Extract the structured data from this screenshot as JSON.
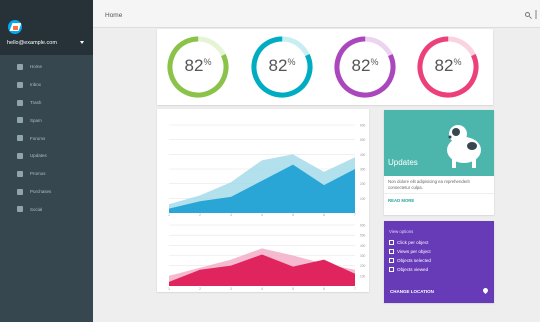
{
  "account": {
    "email": "hello@example.com"
  },
  "header": {
    "title": "Home"
  },
  "sidebar": {
    "items": [
      {
        "label": "Home",
        "icon": "home-icon"
      },
      {
        "label": "Inbox",
        "icon": "inbox-icon"
      },
      {
        "label": "Trash",
        "icon": "trash-icon"
      },
      {
        "label": "Spam",
        "icon": "spam-icon"
      },
      {
        "label": "Forums",
        "icon": "forums-icon"
      },
      {
        "label": "Updates",
        "icon": "flag-icon"
      },
      {
        "label": "Promos",
        "icon": "tag-icon"
      },
      {
        "label": "Purchases",
        "icon": "cart-icon"
      },
      {
        "label": "Social",
        "icon": "people-icon"
      }
    ]
  },
  "gauges": [
    {
      "value_text": "82",
      "unit": "%",
      "fraction": 0.82,
      "color": "#8bc34a",
      "track": "#e6f4d6"
    },
    {
      "value_text": "82",
      "unit": "%",
      "fraction": 0.82,
      "color": "#00acc1",
      "track": "#c7eef3"
    },
    {
      "value_text": "82",
      "unit": "%",
      "fraction": 0.82,
      "color": "#ab47bc",
      "track": "#ecd3f0"
    },
    {
      "value_text": "82",
      "unit": "%",
      "fraction": 0.82,
      "color": "#ec407a",
      "track": "#f9d3e0"
    }
  ],
  "chart_data": [
    {
      "type": "area",
      "x": [
        1,
        2,
        3,
        4,
        5,
        6,
        7
      ],
      "ylim": [
        0,
        600
      ],
      "yticks": [
        "600",
        "500",
        "400",
        "300",
        "200",
        "100"
      ],
      "series": [
        {
          "values": [
            60,
            120,
            210,
            360,
            400,
            280,
            380
          ],
          "color": "#9fd8e8"
        },
        {
          "values": [
            30,
            80,
            110,
            220,
            330,
            190,
            300
          ],
          "color": "#29a5d6"
        }
      ]
    },
    {
      "type": "area",
      "x": [
        1,
        2,
        3,
        4,
        5,
        6,
        7
      ],
      "ylim": [
        0,
        600
      ],
      "yticks": [
        "600",
        "500",
        "400",
        "300",
        "200",
        "100"
      ],
      "series": [
        {
          "values": [
            100,
            180,
            260,
            370,
            300,
            220,
            160
          ],
          "color": "#f2a9c4"
        },
        {
          "values": [
            40,
            160,
            200,
            310,
            190,
            260,
            120
          ],
          "color": "#e0245e"
        }
      ]
    }
  ],
  "updates": {
    "title": "Updates",
    "description": "Non dolore elit adipisicing ea reprehenderit consectetur culpa.",
    "link": "READ MORE"
  },
  "view_options": {
    "title": "View options",
    "items": [
      "Click per object",
      "Views per object",
      "Objects selected",
      "Objects viewed"
    ],
    "button": "CHANGE LOCATION"
  }
}
